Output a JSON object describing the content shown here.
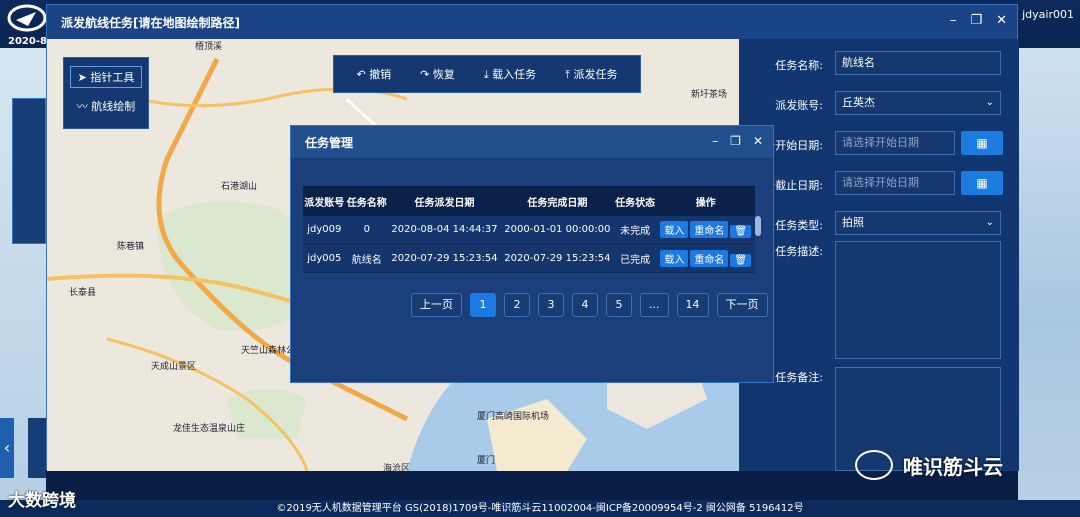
{
  "header": {
    "date": "2020-8-",
    "user": "jdyair001"
  },
  "modal": {
    "title": "派发航线任务[请在地图绘制路径]"
  },
  "map_tools": {
    "pointer_label": "指针工具",
    "draw_label": "航线绘制"
  },
  "actions": {
    "undo": "撤销",
    "redo": "恢复",
    "load": "载入任务",
    "dispatch": "派发任务"
  },
  "map_labels": [
    "石港湖山",
    "陈巷镇",
    "长泰县",
    "天成山景区",
    "天竺山森林公园",
    "龙佳生态温泉山庄",
    "厦门高崎国际机场",
    "海沧区",
    "厦门",
    "新圩茶场",
    "梧顶溪"
  ],
  "form": {
    "name_label": "任务名称:",
    "name_value": "航线名",
    "account_label": "派发账号:",
    "account_value": "丘英杰",
    "start_label": "务开始日期:",
    "start_placeholder": "请选择开始日期",
    "end_label": "务截止日期:",
    "end_placeholder": "请选择开始日期",
    "type_label": "任务类型:",
    "type_value": "拍照",
    "desc_label": "任务描述:",
    "remark_label": "任务备注:"
  },
  "task_dialog": {
    "title": "任务管理",
    "columns": [
      "派发账号",
      "任务名称",
      "任务派发日期",
      "任务完成日期",
      "任务状态",
      "操作"
    ],
    "rows": [
      {
        "account": "jdy009",
        "name": "0",
        "dispatch": "2020-08-04 14:44:37",
        "complete": "2000-01-01 00:00:00",
        "status": "未完成"
      },
      {
        "account": "jdy005",
        "name": "航线名",
        "dispatch": "2020-07-29 15:23:54",
        "complete": "2020-07-29 15:23:54",
        "status": "已完成"
      }
    ],
    "op_load": "载入",
    "op_rename": "重命名",
    "pager": {
      "prev": "上一页",
      "pages": [
        "1",
        "2",
        "3",
        "4",
        "5",
        "...",
        "14"
      ],
      "next": "下一页"
    }
  },
  "footer": "©2019无人机数据管理平台 GS(2018)1709号-唯识筋斗云11002004-闽ICP备20009954号-2 闽公网备 5196412号",
  "watermarks": {
    "left": "大数跨境",
    "right": "唯识筋斗云"
  }
}
